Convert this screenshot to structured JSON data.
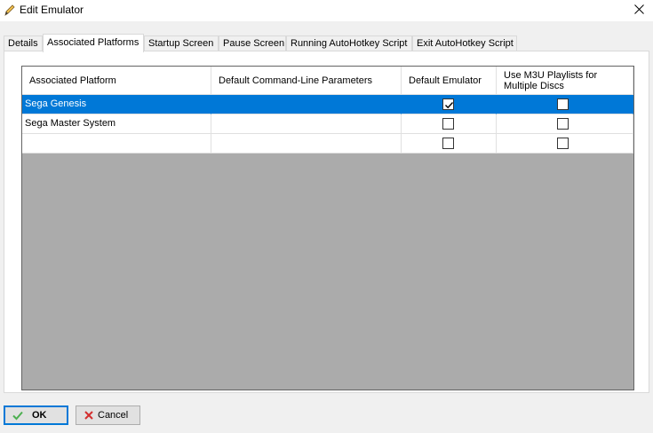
{
  "window": {
    "title": "Edit Emulator",
    "title_icon": "pencil-icon",
    "close_icon": "close-icon"
  },
  "tabs": [
    {
      "label": "Details",
      "active": false
    },
    {
      "label": "Associated Platforms",
      "active": true
    },
    {
      "label": "Startup Screen",
      "active": false
    },
    {
      "label": "Pause Screen",
      "active": false
    },
    {
      "label": "Running AutoHotkey Script",
      "active": false
    },
    {
      "label": "Exit AutoHotkey Script",
      "active": false
    }
  ],
  "grid": {
    "columns": [
      "Associated Platform",
      "Default Command-Line Parameters",
      "Default Emulator",
      "Use M3U Playlists for Multiple Discs"
    ],
    "rows": [
      {
        "platform": "Sega Genesis",
        "params": "",
        "default_emulator": true,
        "use_m3u": false,
        "selected": true
      },
      {
        "platform": "Sega Master System",
        "params": "",
        "default_emulator": false,
        "use_m3u": false,
        "selected": false
      },
      {
        "platform": "",
        "params": "",
        "default_emulator": false,
        "use_m3u": false,
        "selected": false
      }
    ]
  },
  "buttons": {
    "ok_label": "OK",
    "ok_icon": "checkmark-icon",
    "cancel_label": "Cancel",
    "cancel_icon": "x-icon"
  },
  "colors": {
    "selection": "#0078d7",
    "grid_background": "#ababab",
    "ok_icon": "#4caf50",
    "cancel_icon": "#d32f2f"
  }
}
